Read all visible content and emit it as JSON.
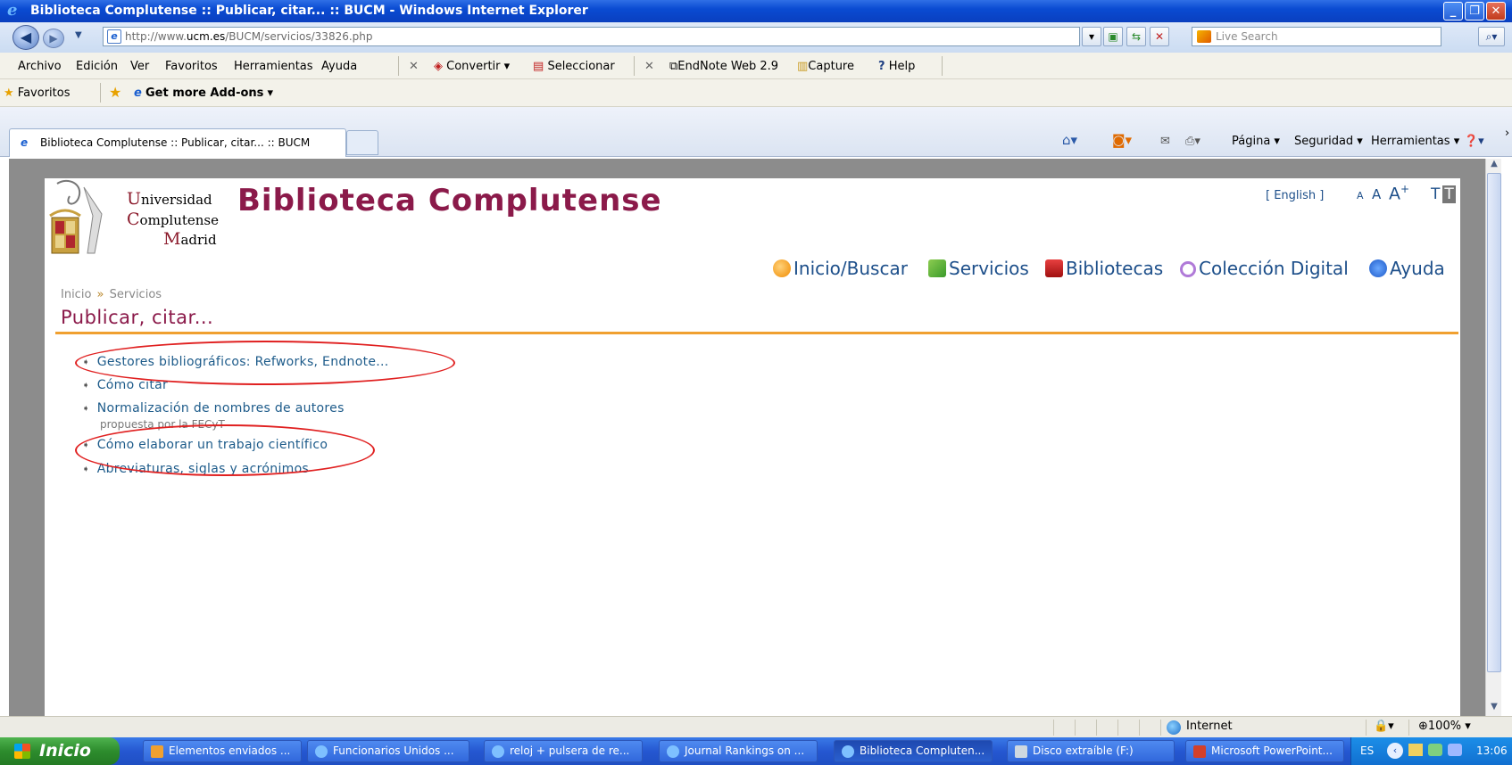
{
  "window": {
    "title": "Biblioteca Complutense :: Publicar, citar... :: BUCM - Windows Internet Explorer",
    "controls": [
      "_",
      "❐",
      "✕"
    ]
  },
  "address": {
    "url_prefix": "http://www.",
    "url_domain": "ucm.es",
    "url_rest": "/BUCM/servicios/33826.php",
    "search_placeholder": "Live Search"
  },
  "menu": {
    "items": [
      "Archivo",
      "Edición",
      "Ver",
      "Favoritos",
      "Herramientas",
      "Ayuda"
    ],
    "toolbar": {
      "convert": "Convertir",
      "select": "Seleccionar",
      "endnote": "EndNote Web 2.9",
      "capture": "Capture",
      "help": "Help"
    }
  },
  "favorites": {
    "label": "Favoritos",
    "addons": "Get more Add-ons"
  },
  "tab": {
    "title": "Biblioteca Complutense :: Publicar, citar... :: BUCM"
  },
  "commandbar": {
    "page": "Página",
    "security": "Seguridad",
    "tools": "Herramientas"
  },
  "site": {
    "uni_line1_cap": "U",
    "uni_line1": "niversidad",
    "uni_line2_cap": "C",
    "uni_line2": "omplutense",
    "uni_line3_cap": "M",
    "uni_line3": "adrid",
    "title": "Biblioteca Complutense",
    "english": "[ English ]",
    "font_small": "A",
    "font_medium": "A",
    "font_large": "A",
    "font_plus": "+",
    "font_tt": "T",
    "font_tt2": "T",
    "nav": [
      "Inicio/Buscar",
      "Servicios",
      "Bibliotecas",
      "Colección Digital",
      "Ayuda"
    ],
    "breadcrumb": [
      "Inicio",
      "»",
      "Servicios"
    ],
    "page_title": "Publicar, citar...",
    "links": [
      "Gestores bibliográficos: Refworks, Endnote...",
      "Cómo citar",
      "Normalización de nombres de autores",
      "Cómo elaborar un trabajo científico",
      "Abreviaturas, siglas y acrónimos"
    ],
    "link_sub": "propuesta por la FECyT",
    "bullet": "➧"
  },
  "status": {
    "zone": "Internet",
    "zoom": "100%"
  },
  "taskbar": {
    "start": "Inicio",
    "tasks": [
      "Elementos enviados ...",
      "Funcionarios Unidos ...",
      "reloj + pulsera de re...",
      "Journal Rankings on ...",
      "Biblioteca Compluten...",
      "Disco extraíble (F:)",
      "Microsoft PowerPoint..."
    ],
    "lang": "ES",
    "clock": "13:06"
  },
  "colors": {
    "brand": "#8b1a4a",
    "link": "#1d5b8a",
    "accent_line": "#f0a030",
    "annotation": "#e02020"
  }
}
